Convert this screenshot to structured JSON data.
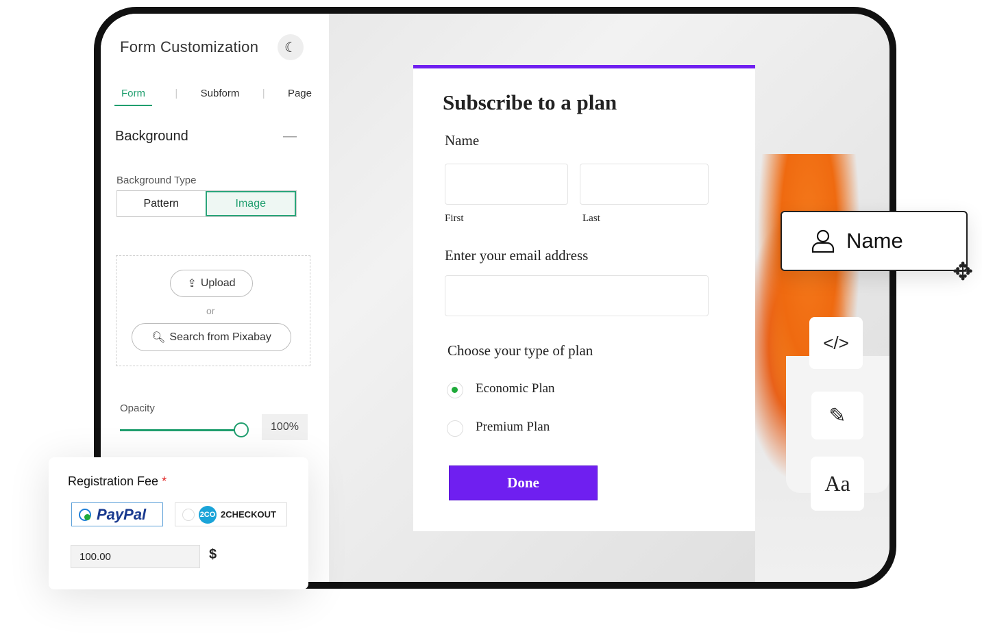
{
  "sidebar": {
    "title": "Form Customization",
    "theme_icon": "moon-icon",
    "tabs": [
      {
        "label": "Form",
        "active": true
      },
      {
        "label": "Subform"
      },
      {
        "label": "Page"
      }
    ],
    "section": "Background",
    "bg_type_label": "Background Type",
    "bg_types": [
      {
        "label": "Pattern"
      },
      {
        "label": "Image",
        "selected": true
      }
    ],
    "upload": "Upload",
    "or": "or",
    "search": "Search from Pixabay",
    "opacity_label": "Opacity",
    "opacity_value": "100%",
    "opacity": 100
  },
  "form": {
    "title": "Subscribe to a plan",
    "name_label": "Name",
    "first": "First",
    "last": "Last",
    "email_label": "Enter your email address",
    "plan_label": "Choose your type of plan",
    "plans": [
      {
        "label": "Economic Plan",
        "selected": true
      },
      {
        "label": "Premium Plan",
        "selected": false
      }
    ],
    "submit": "Done",
    "accent": "#6f1ff0"
  },
  "field_chip": {
    "label": "Name",
    "icon": "user-icon"
  },
  "tools": [
    {
      "icon": "code-icon",
      "glyph": "</>"
    },
    {
      "icon": "pencil-icon",
      "glyph": "✎"
    },
    {
      "icon": "font-icon",
      "glyph": "Aa"
    }
  ],
  "payment": {
    "label": "Registration Fee",
    "required": "*",
    "options": [
      {
        "label": "PayPal",
        "selected": true
      },
      {
        "label": "2CHECKOUT",
        "logo": "2CO"
      }
    ],
    "amount": "100.00",
    "currency": "$"
  }
}
